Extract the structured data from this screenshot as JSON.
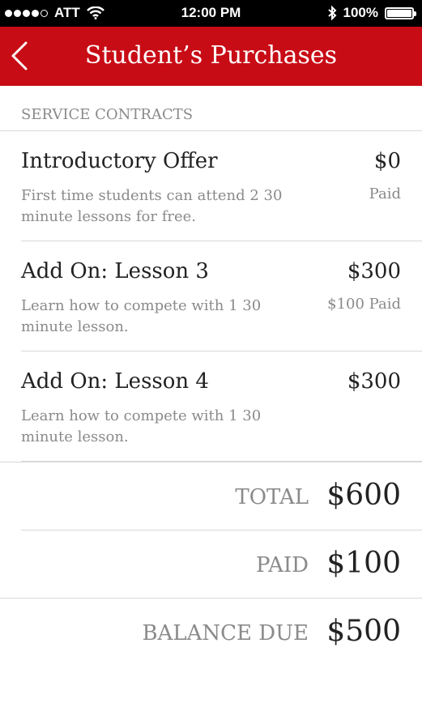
{
  "status_bar": {
    "carrier": "ATT",
    "time": "12:00 PM",
    "battery": "100%",
    "signal_bars_filled": 4,
    "signal_bars_total": 5
  },
  "nav": {
    "title": "Student’s Purchases",
    "back_icon": "chevron-left-icon",
    "color": "#c80c16"
  },
  "section": {
    "heading": "SERVICE CONTRACTS"
  },
  "items": [
    {
      "title": "Introductory Offer",
      "description": "First time students can attend 2 30 minute lessons for free.",
      "price": "$0",
      "status": "Paid"
    },
    {
      "title": "Add On: Lesson 3",
      "description": "Learn how to compete with 1 30 minute lesson.",
      "price": "$300",
      "status": "$100 Paid"
    },
    {
      "title": "Add On: Lesson 4",
      "description": "Learn how to compete with 1 30 minute lesson.",
      "price": "$300",
      "status": ""
    }
  ],
  "totals": {
    "total_label": "TOTAL",
    "total_value": "$600",
    "paid_label": "PAID",
    "paid_value": "$100",
    "balance_label": "BALANCE DUE",
    "balance_value": "$500"
  }
}
